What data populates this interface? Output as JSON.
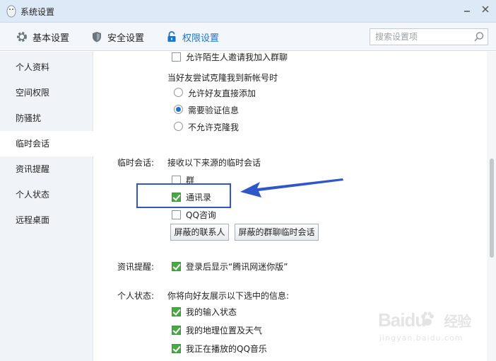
{
  "window": {
    "title": "系统设置"
  },
  "tabs": [
    {
      "label": "基本设置",
      "icon": "gear-icon"
    },
    {
      "label": "安全设置",
      "icon": "shield-icon"
    },
    {
      "label": "权限设置",
      "icon": "lock-icon",
      "active": true
    }
  ],
  "search": {
    "placeholder": "搜索设置项",
    "value": ""
  },
  "sidebar": {
    "items": [
      {
        "label": "个人资料"
      },
      {
        "label": "空间权限"
      },
      {
        "label": "防骚扰"
      },
      {
        "label": "临时会话",
        "selected": true
      },
      {
        "label": "资讯提醒"
      },
      {
        "label": "个人状态"
      },
      {
        "label": "远程桌面"
      }
    ]
  },
  "content": {
    "allow_stranger_invite": {
      "label": "允许陌生人邀请我加入群聊",
      "checked": false
    },
    "clone_section": {
      "heading": "当好友尝试克隆我到新帐号时",
      "options": [
        {
          "label": "允许好友直接添加",
          "selected": false
        },
        {
          "label": "需要验证信息",
          "selected": true
        },
        {
          "label": "不允许克隆我",
          "selected": false
        }
      ]
    },
    "temp_session": {
      "section_label": "临时会话:",
      "heading": "接收以下来源的临时会话",
      "options": [
        {
          "label": "群",
          "checked": false
        },
        {
          "label": "通讯录",
          "checked": true
        },
        {
          "label": "QQ咨询",
          "checked": false
        }
      ],
      "buttons": [
        {
          "label": "屏蔽的联系人"
        },
        {
          "label": "屏蔽的群聊临时会话"
        }
      ]
    },
    "news": {
      "section_label": "资讯提醒:",
      "option": {
        "label": "登录后显示“腾讯网迷你版”",
        "checked": true
      }
    },
    "personal_status": {
      "section_label": "个人状态:",
      "heading": "你将向好友展示以下选中的信息:",
      "options": [
        {
          "label": "我的输入状态",
          "checked": true
        },
        {
          "label": "我的地理位置及天气",
          "checked": true
        },
        {
          "label": "我正在播放的QQ音乐",
          "checked": true
        }
      ]
    }
  },
  "colors": {
    "accent": "#1a74d4",
    "check_green": "#4ca64a",
    "annotation_blue": "#2f57c9"
  },
  "watermark": {
    "brand": "Baidu",
    "brand_cn": "经验",
    "url": "jingyan.baidu.com"
  }
}
